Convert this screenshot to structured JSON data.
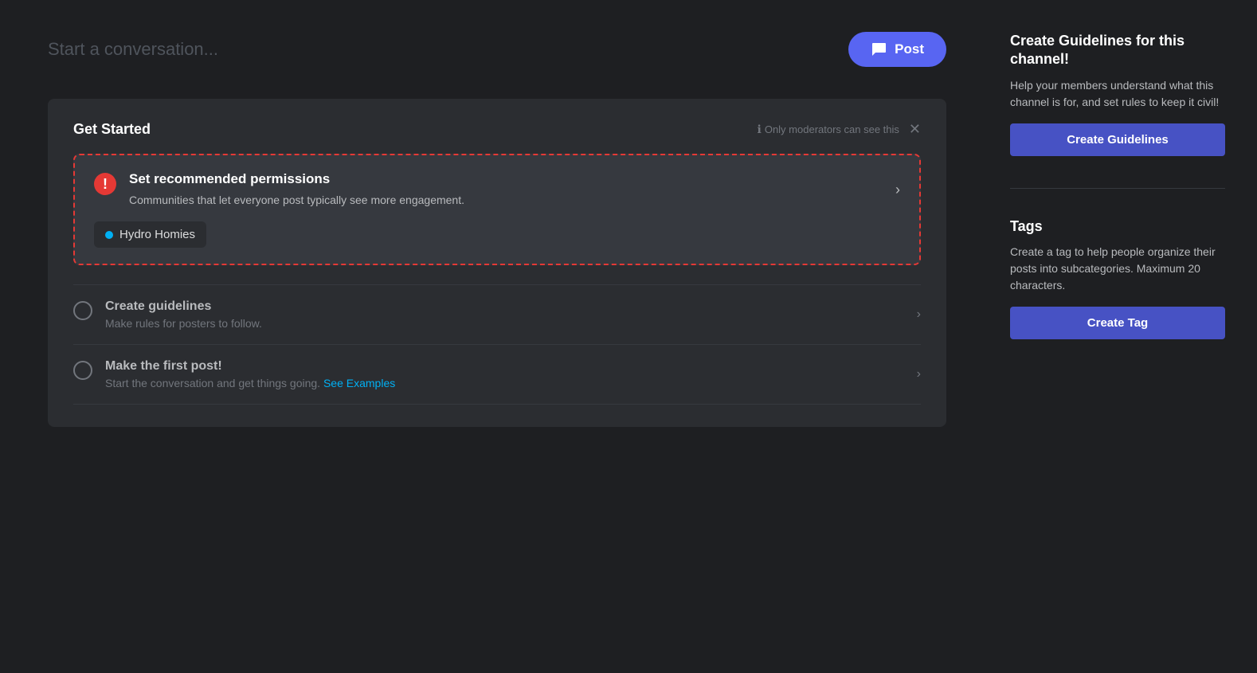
{
  "conversation": {
    "placeholder": "Start a conversation...",
    "post_button_label": "Post"
  },
  "get_started": {
    "title": "Get Started",
    "moderator_note": "Only moderators can see this",
    "permissions_card": {
      "title": "Set recommended permissions",
      "description": "Communities that let everyone post typically see more engagement.",
      "tag_label": "Hydro Homies"
    },
    "checklist": [
      {
        "title": "Create guidelines",
        "description": "Make rules for posters to follow.",
        "link_text": null
      },
      {
        "title": "Make the first post!",
        "description": "Start the conversation and get things going.",
        "link_text": "See Examples"
      }
    ]
  },
  "right_panel": {
    "guidelines_widget": {
      "title": "Create Guidelines for this channel!",
      "description": "Help your members understand what this channel is for, and set rules to keep it civil!",
      "button_label": "Create Guidelines"
    },
    "tags_widget": {
      "title": "Tags",
      "description": "Create a tag to help people organize their posts into subcategories. Maximum 20 characters.",
      "button_label": "Create Tag"
    }
  },
  "icons": {
    "alert": "⚠",
    "chevron_right": "›",
    "close": "✕",
    "info": "ℹ",
    "chat_bubble": "💬"
  }
}
